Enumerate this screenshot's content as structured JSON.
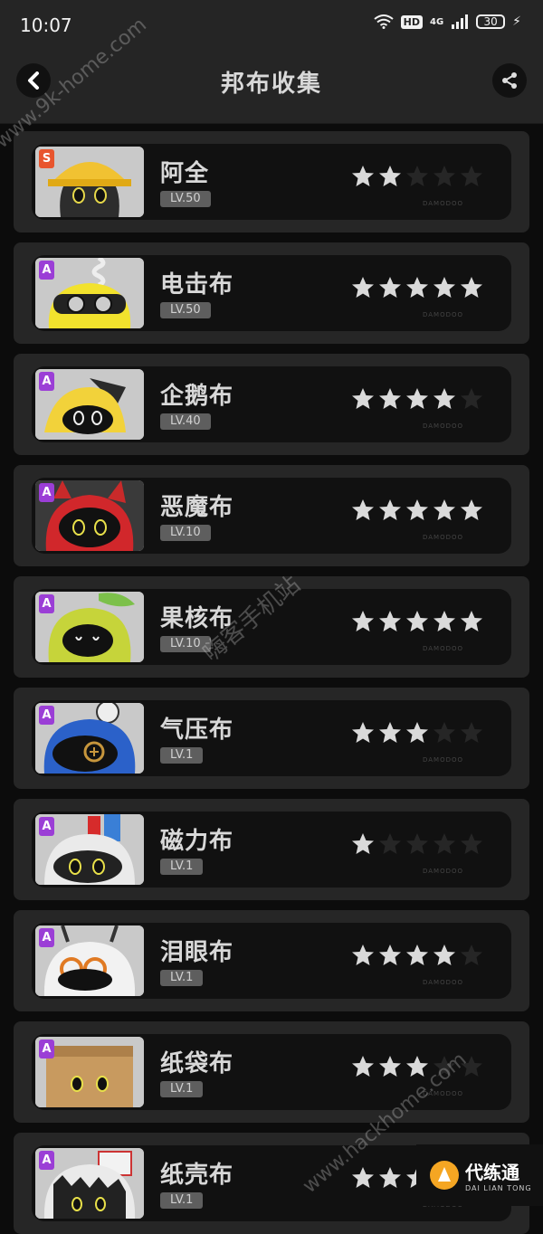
{
  "status_bar": {
    "time": "10:07",
    "hd": "HD",
    "network": "4G",
    "battery": "30"
  },
  "header": {
    "title": "邦布收集"
  },
  "cards": [
    {
      "rank": "S",
      "rank_color": "#e8552e",
      "name": "阿全",
      "level": "LV.50",
      "stars": 2,
      "art": "hardhat"
    },
    {
      "rank": "A",
      "rank_color": "#9b3ed6",
      "name": "电击布",
      "level": "LV.50",
      "stars": 5,
      "art": "yellow-coil"
    },
    {
      "rank": "A",
      "rank_color": "#9b3ed6",
      "name": "企鹅布",
      "level": "LV.40",
      "stars": 4,
      "art": "penguin"
    },
    {
      "rank": "A",
      "rank_color": "#9b3ed6",
      "name": "恶魔布",
      "level": "LV.10",
      "stars": 5,
      "art": "devil"
    },
    {
      "rank": "A",
      "rank_color": "#9b3ed6",
      "name": "果核布",
      "level": "LV.10",
      "stars": 5,
      "art": "seed"
    },
    {
      "rank": "A",
      "rank_color": "#9b3ed6",
      "name": "气压布",
      "level": "LV.1",
      "stars": 3,
      "art": "pressure"
    },
    {
      "rank": "A",
      "rank_color": "#9b3ed6",
      "name": "磁力布",
      "level": "LV.1",
      "stars": 1,
      "art": "magnet"
    },
    {
      "rank": "A",
      "rank_color": "#9b3ed6",
      "name": "泪眼布",
      "level": "LV.1",
      "stars": 4,
      "art": "tears"
    },
    {
      "rank": "A",
      "rank_color": "#9b3ed6",
      "name": "纸袋布",
      "level": "LV.1",
      "stars": 3,
      "art": "paperbag"
    },
    {
      "rank": "A",
      "rank_color": "#9b3ed6",
      "name": "纸壳布",
      "level": "LV.1",
      "stars": 3,
      "art": "cardboard"
    }
  ],
  "card_tag": "DAMODOO",
  "watermarks": {
    "top": "www.9k-home.com",
    "middle": "嗨客手机站",
    "bottom": "www.hackhome.com"
  },
  "corner_logo": {
    "title": "代练通",
    "subtitle": "DAI LIAN TONG"
  }
}
